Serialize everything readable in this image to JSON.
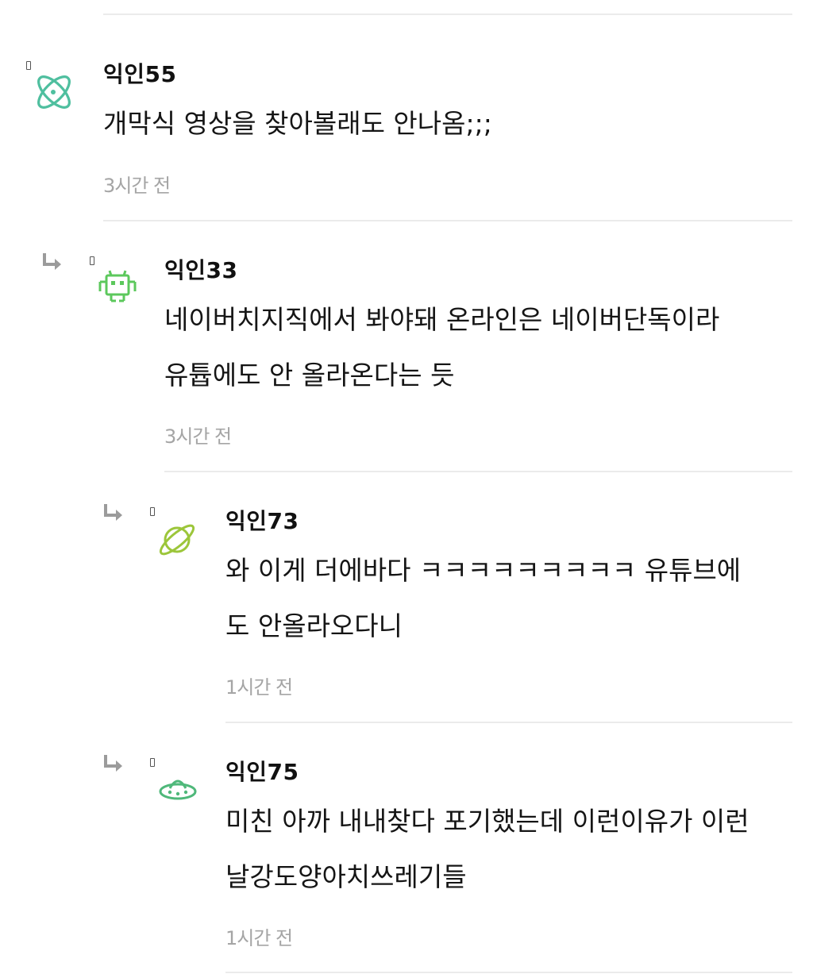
{
  "comments": [
    {
      "author": "익인55",
      "avatar_icon": "atom-icon",
      "avatar_color": "#4fbf9f",
      "lines": [
        "개막식 영상을 찾아볼래도 안나옴;;;"
      ],
      "time": "3시간 전",
      "is_reply": false
    },
    {
      "author": "익인33",
      "avatar_icon": "space-invader-icon",
      "avatar_color": "#5cc85c",
      "lines": [
        "네이버치지직에서 봐야돼 온라인은 네이버단독이라",
        "유튭에도 안 올라온다는 듯"
      ],
      "time": "3시간 전",
      "is_reply": true
    },
    {
      "author": "익인73",
      "avatar_icon": "planet-icon",
      "avatar_color": "#9cc63a",
      "lines": [
        "와 이게 더에바다 ㅋㅋㅋㅋㅋㅋㅋㅋㅋ 유튜브에",
        "도 안올라오다니"
      ],
      "time": "1시간 전",
      "is_reply": true
    },
    {
      "author": "익인75",
      "avatar_icon": "ufo-icon",
      "avatar_color": "#4fb87a",
      "lines": [
        "미친 아까 내내찾다 포기했는데 이런이유가 이런",
        "날강도양아치쓰레기들"
      ],
      "time": "1시간 전",
      "is_reply": true
    }
  ]
}
